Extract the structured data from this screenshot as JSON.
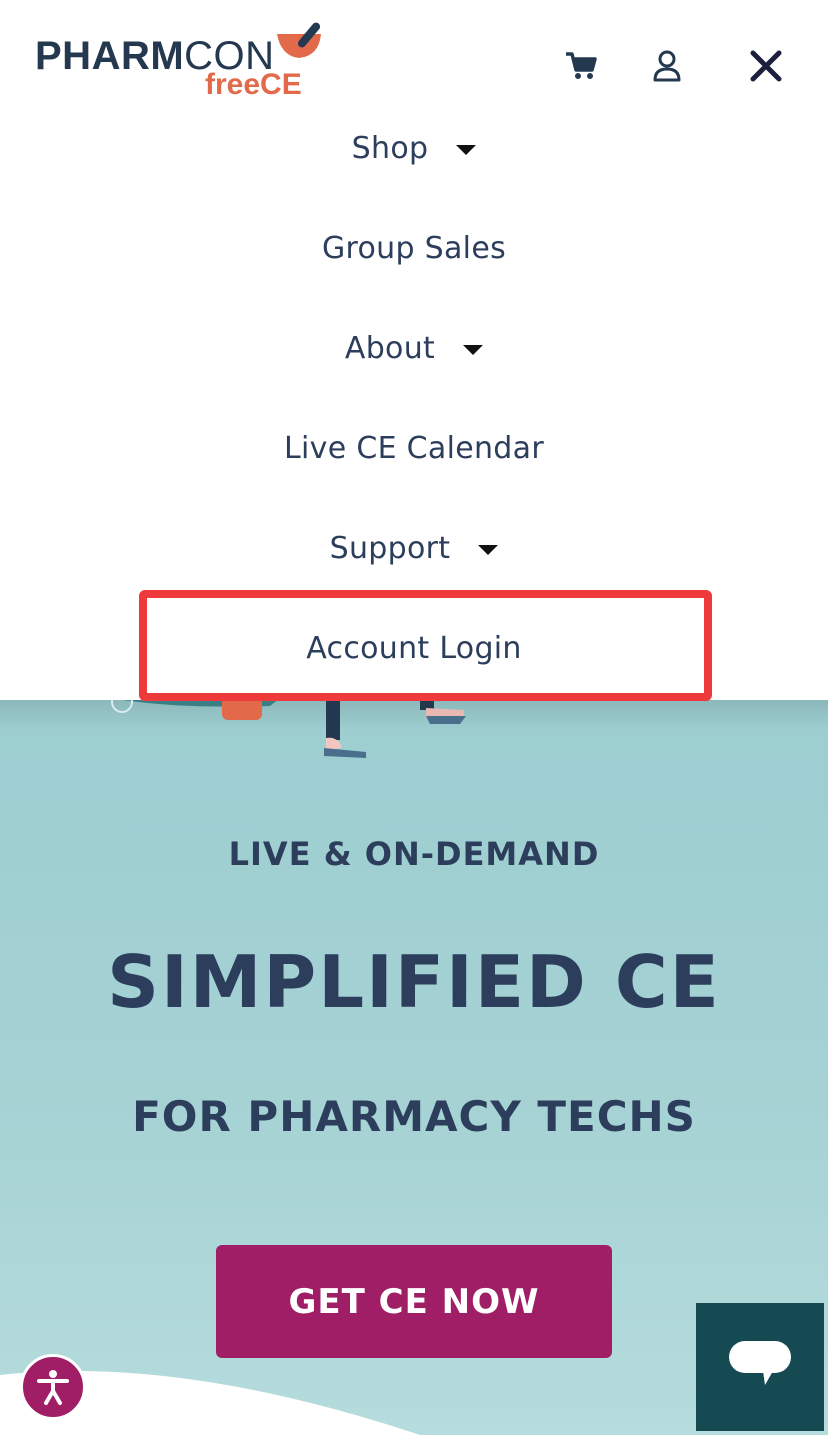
{
  "header": {
    "logo_main_bold": "PHARM",
    "logo_main_light": "CON",
    "logo_sub": "freeCE",
    "icons": [
      "cart-icon",
      "user-icon",
      "close-icon"
    ]
  },
  "menu": {
    "items": [
      {
        "label": "Shop",
        "has_dropdown": true
      },
      {
        "label": "Group Sales",
        "has_dropdown": false
      },
      {
        "label": "About",
        "has_dropdown": true
      },
      {
        "label": "Live CE Calendar",
        "has_dropdown": false
      },
      {
        "label": "Support",
        "has_dropdown": true
      },
      {
        "label": "Account Login",
        "has_dropdown": false,
        "highlighted": true
      }
    ]
  },
  "hero": {
    "kicker": "LIVE & ON-DEMAND",
    "title": "SIMPLIFIED CE",
    "subtitle": "FOR PHARMACY TECHS",
    "cta_label": "GET CE NOW"
  },
  "widgets": {
    "accessibility_icon": "accessibility-icon",
    "chat_icon": "chat-icon"
  },
  "colors": {
    "navy": "#2c3e5b",
    "brand_orange": "#e26a4a",
    "cta_magenta": "#a01e66",
    "hero_teal": "#9ccdd0",
    "chat_teal": "#164a52",
    "highlight_red": "#ef3a3c"
  }
}
